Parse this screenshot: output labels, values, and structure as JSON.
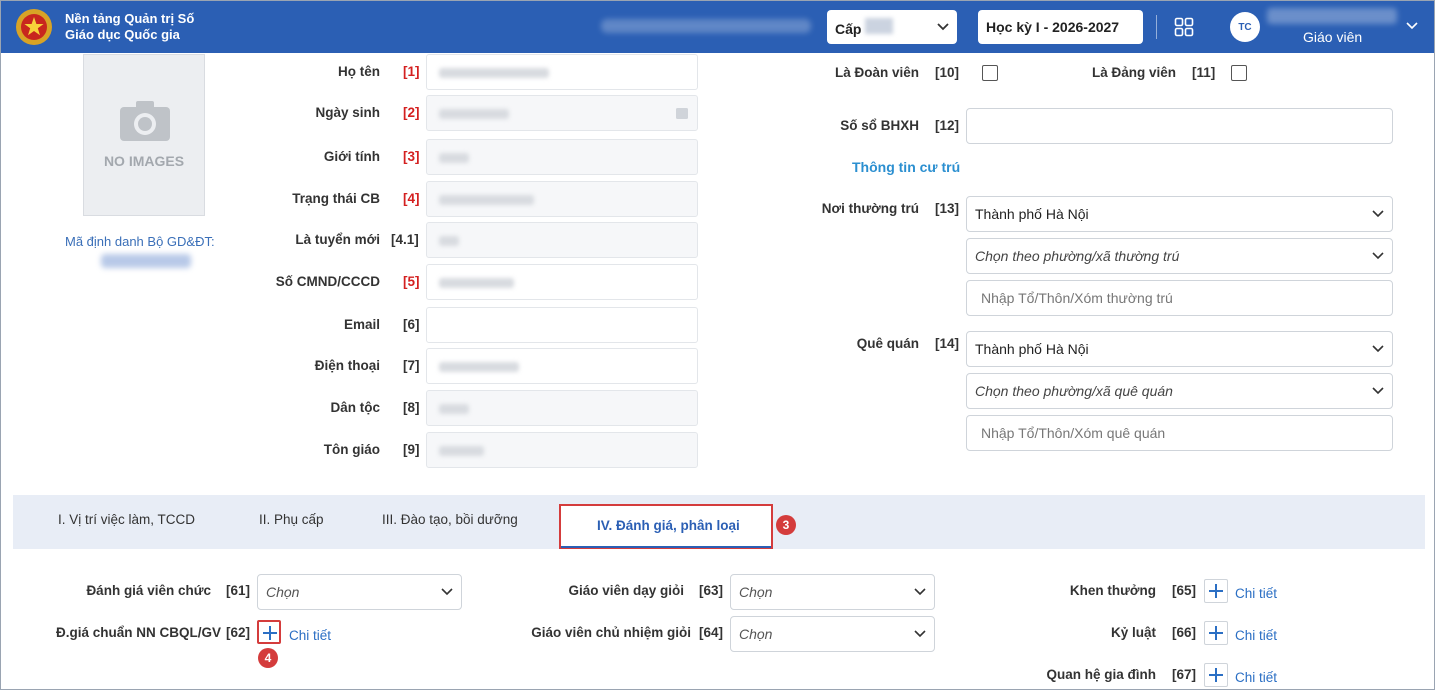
{
  "header": {
    "brand_line1": "Nền tảng Quản trị Số",
    "brand_line2": "Giáo dục Quốc gia",
    "level_label": "Cấp",
    "semester": "Học kỳ I - 2026-2027",
    "avatar_initials": "TC",
    "role": "Giáo viên"
  },
  "profile": {
    "no_image": "NO IMAGES",
    "id_label": "Mã định danh Bộ GD&ĐT:"
  },
  "left_fields": [
    {
      "label": "Họ tên",
      "num": "[1]"
    },
    {
      "label": "Ngày sinh",
      "num": "[2]"
    },
    {
      "label": "Giới tính",
      "num": "[3]"
    },
    {
      "label": "Trạng thái CB",
      "num": "[4]"
    },
    {
      "label": "Là tuyển mới",
      "num": "[4.1]"
    },
    {
      "label": "Số CMND/CCCD",
      "num": "[5]"
    },
    {
      "label": "Email",
      "num": "[6]"
    },
    {
      "label": "Điện thoại",
      "num": "[7]"
    },
    {
      "label": "Dân tộc",
      "num": "[8]"
    },
    {
      "label": "Tôn giáo",
      "num": "[9]"
    }
  ],
  "right": {
    "doan_vien": "Là Đoàn viên",
    "doan_vien_num": "[10]",
    "dang_vien": "Là Đảng viên",
    "dang_vien_num": "[11]",
    "bhxh": "Số sổ BHXH",
    "bhxh_num": "[12]",
    "residence_title": "Thông tin cư trú",
    "thuong_tru": "Nơi thường trú",
    "thuong_tru_num": "[13]",
    "thuong_tru_city": "Thành phố Hà Nội",
    "thuong_tru_ward": "Chọn theo phường/xã thường trú",
    "thuong_tru_detail": "Nhập Tổ/Thôn/Xóm thường trú",
    "que_quan": "Quê quán",
    "que_quan_num": "[14]",
    "que_quan_city": "Thành phố Hà Nội",
    "que_quan_ward": "Chọn theo phường/xã quê quán",
    "que_quan_detail": "Nhập Tổ/Thôn/Xóm quê quán"
  },
  "tabs": [
    {
      "label": "I. Vị trí việc làm, TCCD"
    },
    {
      "label": "II. Phụ cấp"
    },
    {
      "label": "III. Đào tạo, bồi dưỡng"
    },
    {
      "label": "IV. Đánh giá, phân loại"
    }
  ],
  "badges": {
    "tab": "3",
    "plus": "4"
  },
  "eval": {
    "f61": "Đánh giá viên chức",
    "n61": "[61]",
    "f62": "Đ.giá chuẩn NN CBQL/GV",
    "n62": "[62]",
    "f63": "Giáo viên dạy giỏi",
    "n63": "[63]",
    "f64": "Giáo viên chủ nhiệm giỏi",
    "n64": "[64]",
    "f65": "Khen thưởng",
    "n65": "[65]",
    "f66": "Kỷ luật",
    "n66": "[66]",
    "f67": "Quan hệ gia đình",
    "n67": "[67]",
    "choose": "Chọn",
    "detail": "Chi tiết"
  }
}
